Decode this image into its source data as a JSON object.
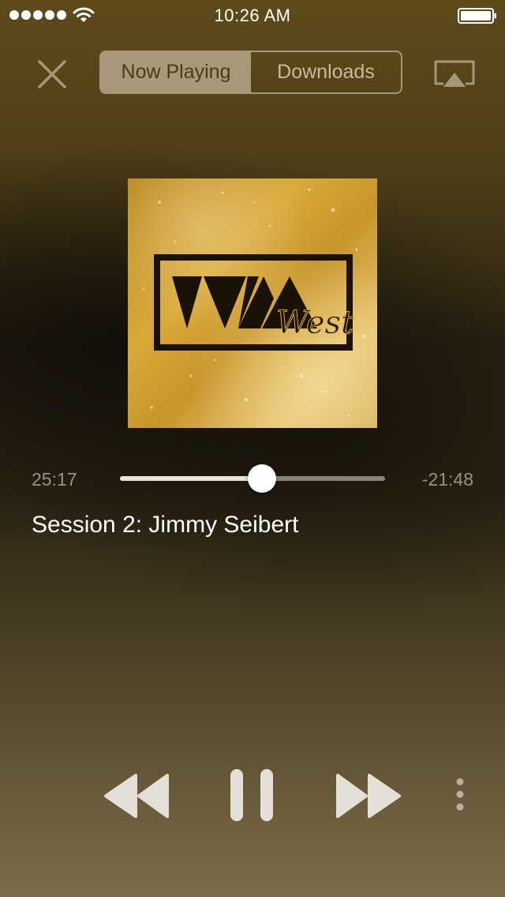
{
  "status_bar": {
    "time": "10:26 AM",
    "signal_icon": "signal-dots-icon",
    "wifi_icon": "wifi-icon",
    "battery_icon": "battery-icon",
    "battery_level": 1.0
  },
  "nav": {
    "close_icon": "close-icon",
    "tabs": [
      {
        "label": "Now Playing",
        "active": true
      },
      {
        "label": "Downloads",
        "active": false
      }
    ],
    "airplay_icon": "airplay-icon"
  },
  "artwork": {
    "logo_text": "West"
  },
  "player": {
    "elapsed": "25:17",
    "remaining": "-21:48",
    "progress": 0.537,
    "title": "Session 2: Jimmy Seibert"
  },
  "controls": {
    "rewind_icon": "rewind-icon",
    "pause_icon": "pause-icon",
    "forward_icon": "fast-forward-icon",
    "more_icon": "more-vertical-icon"
  },
  "colors": {
    "segment_accent": "#a8987a",
    "text_muted": "#9b9180",
    "control_fill": "#e4e0d8"
  }
}
